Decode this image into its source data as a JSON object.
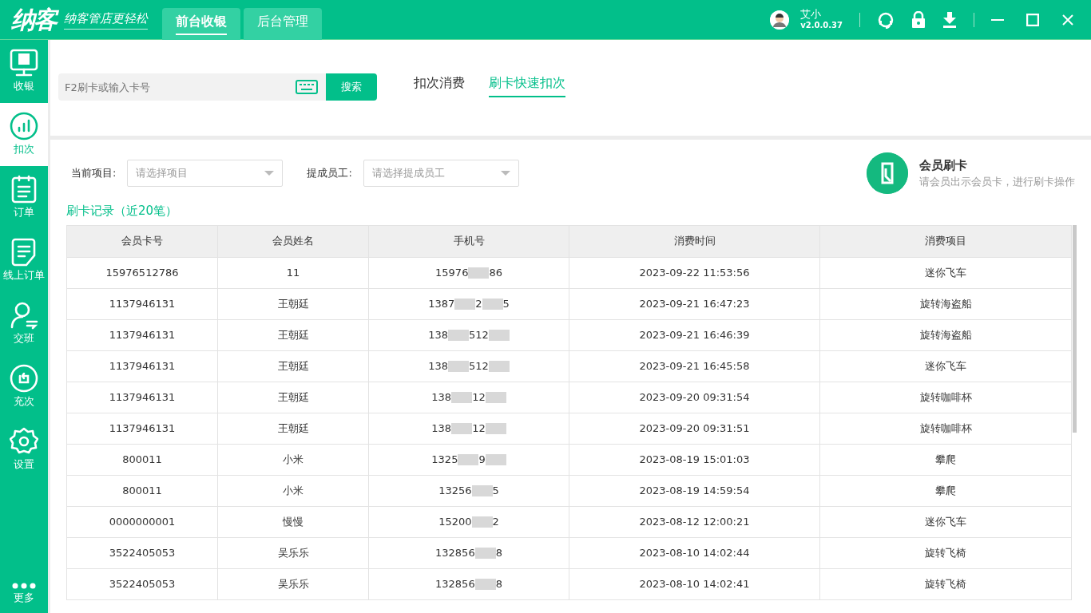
{
  "app": {
    "logo": "纳客",
    "slogan": "纳客管店更轻松"
  },
  "top_tabs": [
    {
      "label": "前台收银",
      "selected": true
    },
    {
      "label": "后台管理",
      "selected": false
    }
  ],
  "user": {
    "name": "艾小",
    "version": "v2.0.0.37"
  },
  "sidebar": [
    {
      "label": "收银",
      "selected": false
    },
    {
      "label": "扣次",
      "selected": true
    },
    {
      "label": "订单",
      "selected": false
    },
    {
      "label": "线上订单",
      "selected": false
    },
    {
      "label": "交班",
      "selected": false
    },
    {
      "label": "充次",
      "selected": false
    },
    {
      "label": "设置",
      "selected": false
    },
    {
      "label": "更多",
      "selected": false
    }
  ],
  "search": {
    "placeholder": "F2刷卡或输入卡号",
    "button": "搜索"
  },
  "mode_tabs": [
    {
      "label": "扣次消费",
      "selected": false
    },
    {
      "label": "刷卡快速扣次",
      "selected": true
    }
  ],
  "filters": [
    {
      "label": "当前项目:",
      "placeholder": "请选择项目"
    },
    {
      "label": "提成员工:",
      "placeholder": "请选择提成员工"
    }
  ],
  "card_prompt": {
    "title": "会员刷卡",
    "hint": "请会员出示会员卡，进行刷卡操作"
  },
  "records_title": "刷卡记录（近20笔）",
  "table": {
    "columns": [
      "会员卡号",
      "会员姓名",
      "手机号",
      "消费时间",
      "消费项目"
    ],
    "rows": [
      {
        "card": "15976512786",
        "name": "11",
        "phone_parts": [
          "15976",
          "86"
        ],
        "ends_masked": false,
        "time": "2023-09-22 11:53:56",
        "item": "迷你飞车"
      },
      {
        "card": "1137946131",
        "name": "王朝廷",
        "phone_parts": [
          "1387",
          "2",
          "5"
        ],
        "ends_masked": false,
        "time": "2023-09-21 16:47:23",
        "item": "旋转海盗船"
      },
      {
        "card": "1137946131",
        "name": "王朝廷",
        "phone_parts": [
          "138",
          "512"
        ],
        "ends_masked": true,
        "time": "2023-09-21 16:46:39",
        "item": "旋转海盗船"
      },
      {
        "card": "1137946131",
        "name": "王朝廷",
        "phone_parts": [
          "138",
          "512"
        ],
        "ends_masked": true,
        "time": "2023-09-21 16:45:58",
        "item": "迷你飞车"
      },
      {
        "card": "1137946131",
        "name": "王朝廷",
        "phone_parts": [
          "138",
          "12"
        ],
        "ends_masked": true,
        "time": "2023-09-20 09:31:54",
        "item": "旋转咖啡杯"
      },
      {
        "card": "1137946131",
        "name": "王朝廷",
        "phone_parts": [
          "138",
          "12"
        ],
        "ends_masked": true,
        "time": "2023-09-20 09:31:51",
        "item": "旋转咖啡杯"
      },
      {
        "card": "800011",
        "name": "小米",
        "phone_parts": [
          "1325",
          "9"
        ],
        "ends_masked": true,
        "time": "2023-08-19 15:01:03",
        "item": "攀爬"
      },
      {
        "card": "800011",
        "name": "小米",
        "phone_parts": [
          "13256",
          "5"
        ],
        "ends_masked": false,
        "time": "2023-08-19 14:59:54",
        "item": "攀爬"
      },
      {
        "card": "0000000001",
        "name": "慢慢",
        "phone_parts": [
          "15200",
          "2"
        ],
        "ends_masked": false,
        "time": "2023-08-12 12:00:21",
        "item": "迷你飞车"
      },
      {
        "card": "3522405053",
        "name": "吴乐乐",
        "phone_parts": [
          "132856",
          "8"
        ],
        "ends_masked": false,
        "time": "2023-08-10 14:02:44",
        "item": "旋转飞椅"
      },
      {
        "card": "3522405053",
        "name": "吴乐乐",
        "phone_parts": [
          "132856",
          "8"
        ],
        "ends_masked": false,
        "time": "2023-08-10 14:02:41",
        "item": "旋转飞椅"
      }
    ]
  }
}
